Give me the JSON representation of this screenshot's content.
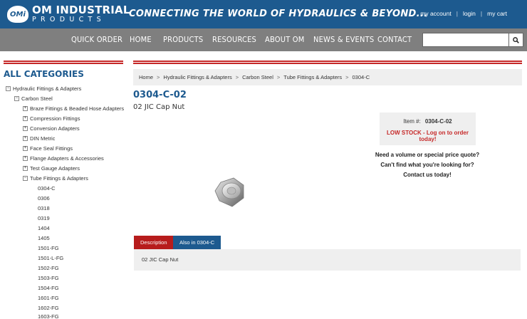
{
  "header": {
    "logo_badge": "OMi",
    "logo_line1": "OM INDUSTRIAL",
    "logo_line2": "PRODUCTS",
    "tagline": "CONNECTING THE WORLD OF HYDRAULICS & BEYOND...",
    "account_links": [
      "my account",
      "login",
      "my cart"
    ],
    "colors": {
      "header_bg": "#1d5a8f",
      "nav_bg": "#7f7f7f",
      "accent_red": "#c62828"
    }
  },
  "nav": {
    "items": [
      "QUICK ORDER",
      "HOME",
      "PRODUCTS",
      "RESOURCES",
      "ABOUT OM",
      "NEWS & EVENTS",
      "CONTACT"
    ],
    "search_placeholder": "",
    "search_icon": "magnifier-icon"
  },
  "sidebar": {
    "title": "ALL CATEGORIES",
    "tree": {
      "root": {
        "label": "Hydraulic Fittings & Adapters",
        "toggle": "−"
      },
      "level1": {
        "label": "Carbon Steel",
        "toggle": "−"
      },
      "level2": [
        {
          "label": "Braze Fittings & Beaded Hose Adapters",
          "toggle": "+"
        },
        {
          "label": "Compression Fittings",
          "toggle": "+"
        },
        {
          "label": "Conversion Adapters",
          "toggle": "+"
        },
        {
          "label": "DIN Metric",
          "toggle": "+"
        },
        {
          "label": "Face Seal Fittings",
          "toggle": "+"
        },
        {
          "label": "Flange Adapters & Accessories",
          "toggle": "+"
        },
        {
          "label": "Test Gauge Adapters",
          "toggle": "+"
        },
        {
          "label": "Tube Fittings & Adapters",
          "toggle": "−"
        }
      ],
      "level3": [
        "0304-C",
        "0306",
        "0318",
        "0319",
        "1404",
        "1405",
        "1501-FG",
        "1501-L-FG",
        "1502-FG",
        "1503-FG",
        "1504-FG",
        "1601-FG",
        "1602-FG",
        "1603-FG"
      ]
    }
  },
  "breadcrumb": [
    "Home",
    "Hydraulic Fittings & Adapters",
    "Carbon Steel",
    "Tube Fittings & Adapters",
    "0304-C"
  ],
  "breadcrumb_separator": ">",
  "product": {
    "code": "0304-C-02",
    "name": "02 JIC Cap Nut",
    "item_label": "Item #:",
    "item_number": "0304-C-02",
    "stock_message": "LOW STOCK - Log on to order today!",
    "quote_lines": [
      "Need a volume or special price quote?",
      "Can't find what you're looking for?",
      "Contact us today!"
    ],
    "image_icon": "cap-nut-image"
  },
  "tabs": {
    "items": [
      "Description",
      "Also in 0304-C"
    ],
    "active": 0,
    "description_text": "02 JIC Cap Nut"
  }
}
